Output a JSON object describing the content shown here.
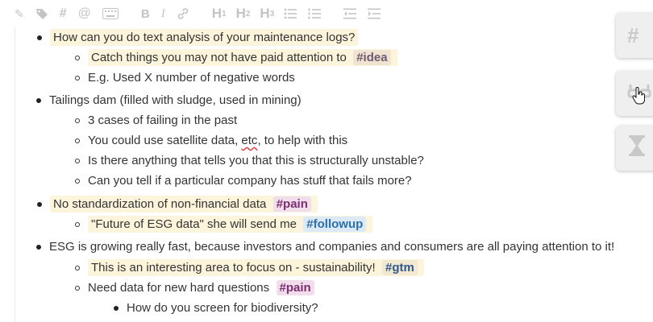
{
  "toolbar": {
    "buttons": [
      {
        "name": "pen-icon",
        "glyph": "✎"
      },
      {
        "name": "tag-icon",
        "glyph": "⬢"
      },
      {
        "name": "hash-icon",
        "glyph": "#"
      },
      {
        "name": "at-icon",
        "glyph": "@"
      },
      {
        "name": "keyboard-icon",
        "glyph": "⌨"
      }
    ],
    "bold": "B",
    "italic": "I",
    "link": "⛓",
    "h1": "H",
    "h1_sub": "1",
    "h2": "H",
    "h2_sub": "2",
    "h3": "H",
    "h3_sub": "3",
    "bullet_list": "☰",
    "numbered_list": "☷",
    "outdent": "⇤",
    "indent": "⇥"
  },
  "outline": {
    "r1": "How can you do text analysis of your maintenance logs?",
    "r2_text": "Catch things you may not have paid attention to",
    "r2_tag": "#idea",
    "r3": "E.g. Used X number of negative words",
    "r4": "Tailings dam (filled with sludge, used in mining)",
    "r5": "3 cases of failing in the past",
    "r6_a": "You could use satellite data,",
    "r6_spell": "etc",
    "r6_b": ", to help with this",
    "r7": "Is there anything that tells you that this is structurally unstable?",
    "r8": "Can you tell if a particular company has stuff that fails more?",
    "r9_text": "No standardization of non-financial data",
    "r9_tag": "#pain",
    "r10_text": "\"Future of ESG data\" she will send me",
    "r10_tag": "#followup",
    "r11": "ESG is growing really fast, because investors and companies and consumers are all paying attention to it!",
    "r12_text": "This is an interesting area to focus on - sustainability!",
    "r12_tag": "#gtm",
    "r13_text": "Need data for new hard questions",
    "r13_tag": "#pain",
    "r14": "How do you screen for biodiversity?"
  },
  "side_tabs": {
    "hash": "#",
    "glasses": "⌓",
    "hourglass": "⧗"
  }
}
